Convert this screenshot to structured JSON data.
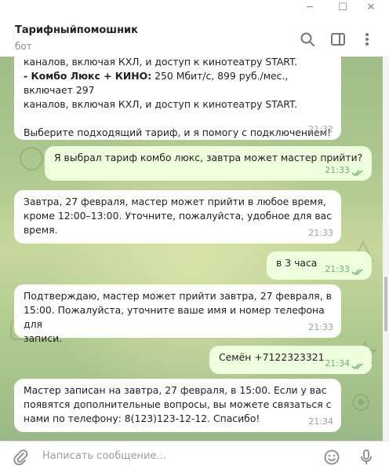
{
  "window": {
    "min_glyph": "─",
    "max_glyph": "☐",
    "close_glyph": "✕"
  },
  "header": {
    "chat_name": "Тарифныйпомошник",
    "status": "бот"
  },
  "messages": [
    {
      "direction": "in",
      "line1": "каналов, включая КХЛ, и доступ к кинотеатру START.",
      "bold_prefix": "- Комбо Люкс + КИНО:",
      "line2_rest": " 250 Мбит/с, 899 руб./мес., включает 297",
      "line3": "каналов, включая КХЛ, и доступ к кинотеатру START.",
      "line4": "Выберите подходящий тариф, и я помогу с подключением!",
      "time": "21:32"
    },
    {
      "direction": "out",
      "text": "Я выбрал тариф комбо люкс, завтра может мастер прийти?",
      "time": "21:33"
    },
    {
      "direction": "in",
      "text": "Завтра, 27 февраля, мастер может прийти в любое время,\nкроме 12:00–13:00. Уточните, пожалуйста, удобное для вас\nвремя.",
      "time": "21:33"
    },
    {
      "direction": "out",
      "text": "в 3 часа",
      "time": "21:33"
    },
    {
      "direction": "in",
      "text": "Подтверждаю, мастер может прийти завтра, 27 февраля, в\n15:00. Пожалуйста, уточните ваше имя и номер телефона для\nзаписи.",
      "time": "21:33"
    },
    {
      "direction": "out",
      "text": "Семён +7122323321",
      "time": "21:34"
    },
    {
      "direction": "in",
      "text": "Мастер записан на завтра, 27 февраля, в 15:00. Если у вас\nпоявятся дополнительные вопросы, вы можете связаться с\nнами по телефону: 8(123)123-12-12. Спасибо!",
      "time": "21:34"
    }
  ],
  "composer": {
    "placeholder": "Написать сообщение..."
  },
  "colors": {
    "incoming_bubble": "#ffffff",
    "outgoing_bubble": "#eeffde",
    "outgoing_time": "#6fb36a",
    "incoming_time": "#9aa0a6"
  }
}
